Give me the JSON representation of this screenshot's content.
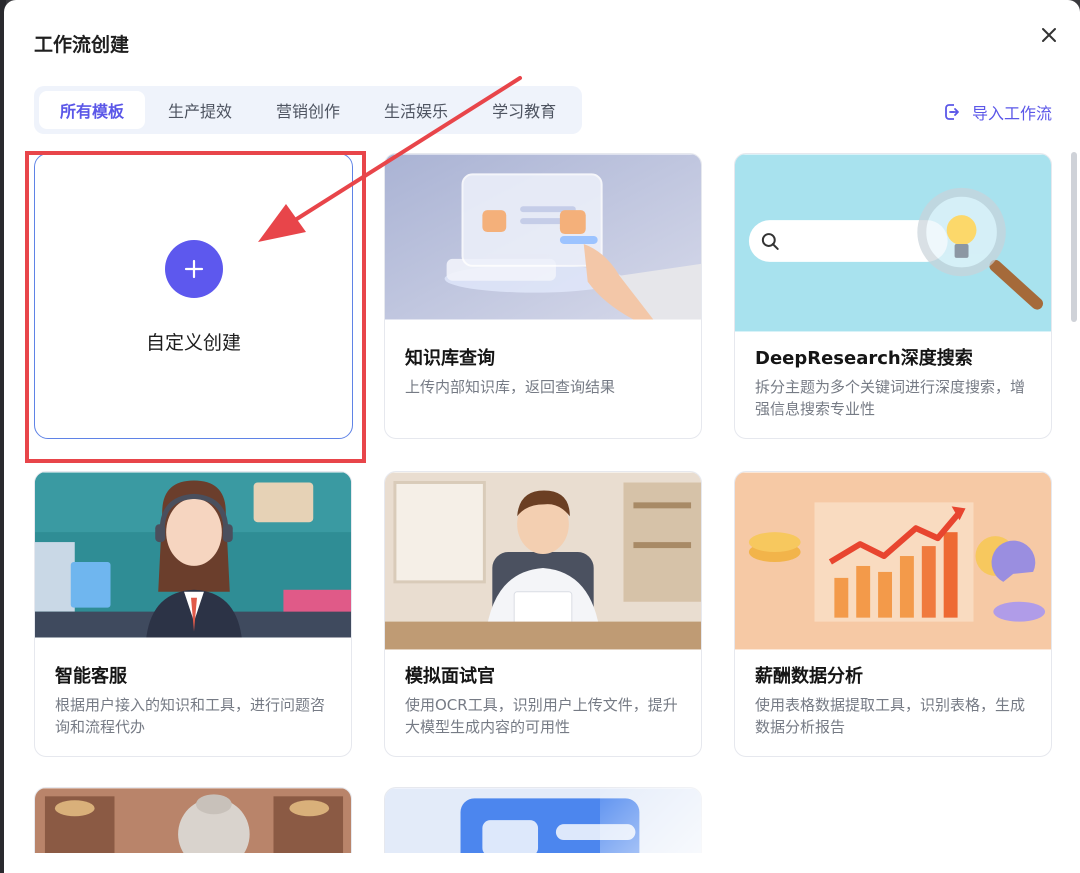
{
  "modal": {
    "title": "工作流创建",
    "close_icon": "close-icon"
  },
  "tabs": [
    {
      "label": "所有模板",
      "active": true
    },
    {
      "label": "生产提效",
      "active": false
    },
    {
      "label": "营销创作",
      "active": false
    },
    {
      "label": "生活娱乐",
      "active": false
    },
    {
      "label": "学习教育",
      "active": false
    }
  ],
  "import": {
    "label": "导入工作流",
    "icon": "import-icon"
  },
  "custom_create": {
    "label": "自定义创建",
    "icon": "plus-icon"
  },
  "templates": [
    {
      "title": "知识库查询",
      "desc": "上传内部知识库，返回查询结果"
    },
    {
      "title": "DeepResearch深度搜索",
      "desc": "拆分主题为多个关键词进行深度搜索，增强信息搜索专业性"
    },
    {
      "title": "智能客服",
      "desc": "根据用户接入的知识和工具，进行问题咨询和流程代办"
    },
    {
      "title": "模拟面试官",
      "desc": "使用OCR工具，识别用户上传文件，提升大模型生成内容的可用性"
    },
    {
      "title": "薪酬数据分析",
      "desc": "使用表格数据提取工具，识别表格，生成数据分析报告"
    }
  ],
  "colors": {
    "accent": "#5b57e8",
    "highlight": "#e8454a"
  }
}
